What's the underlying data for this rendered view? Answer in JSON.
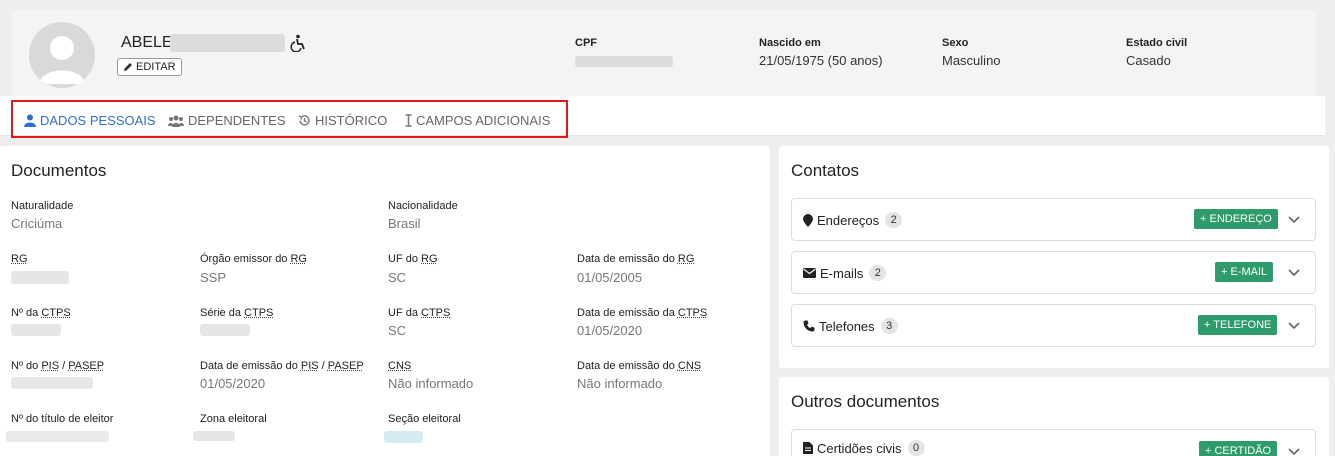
{
  "header": {
    "name": "ABELE",
    "edit_label": "EDITAR",
    "cpf_label": "CPF",
    "birth_label": "Nascido em",
    "birth_value": "21/05/1975 (50 anos)",
    "sex_label": "Sexo",
    "sex_value": "Masculino",
    "civil_label": "Estado civil",
    "civil_value": "Casado"
  },
  "tabs": [
    {
      "label": "DADOS PESSOAIS",
      "icon": "user-icon",
      "active": true
    },
    {
      "label": "DEPENDENTES",
      "icon": "users-icon",
      "active": false
    },
    {
      "label": "HISTÓRICO",
      "icon": "history-icon",
      "active": false
    },
    {
      "label": "CAMPOS ADICIONAIS",
      "icon": "text-cursor-icon",
      "active": false
    }
  ],
  "documentos": {
    "title": "Documentos",
    "naturalidade_label": "Naturalidade",
    "naturalidade_value": "Criciúma",
    "nacionalidade_label": "Nacionalidade",
    "nacionalidade_value": "Brasil",
    "rg_label": "RG",
    "orgao_rg_label_pre": "Órgão emissor do ",
    "orgao_rg_abbr": "RG",
    "orgao_rg_value": "SSP",
    "uf_rg_label_pre": "UF do ",
    "uf_rg_abbr": "RG",
    "uf_rg_value": "SC",
    "data_rg_label_pre": "Data de emissão do ",
    "data_rg_abbr": "RG",
    "data_rg_value": "01/05/2005",
    "ctps_label_pre": "Nº da ",
    "ctps_abbr": "CTPS",
    "serie_ctps_label_pre": "Série da ",
    "serie_ctps_abbr": "CTPS",
    "uf_ctps_label_pre": "UF da ",
    "uf_ctps_abbr": "CTPS",
    "uf_ctps_value": "SC",
    "data_ctps_label_pre": "Data de emissão da ",
    "data_ctps_abbr": "CTPS",
    "data_ctps_value": "01/05/2020",
    "pis_label_pre": "Nº do ",
    "pis_abbr": "PIS",
    "pis_sep": " / ",
    "pasep_abbr": "PASEP",
    "data_pis_label_pre": "Data de emissão do ",
    "data_pis_value": "01/05/2020",
    "cns_abbr": "CNS",
    "cns_value": "Não informado",
    "data_cns_label_pre": "Data de emissão do ",
    "data_cns_value": "Não informado",
    "titulo_label": "Nº do título de eleitor",
    "zona_label": "Zona eleitoral",
    "secao_label": "Seção eleitoral"
  },
  "contatos": {
    "title": "Contatos",
    "rows": [
      {
        "label": "Endereços",
        "count": "2",
        "button": "+ ENDEREÇO",
        "icon": "map-marker-icon"
      },
      {
        "label": "E-mails",
        "count": "2",
        "button": "+ E-MAIL",
        "icon": "envelope-icon"
      },
      {
        "label": "Telefones",
        "count": "3",
        "button": "+ TELEFONE",
        "icon": "phone-icon"
      }
    ]
  },
  "outros": {
    "title": "Outros documentos",
    "rows": [
      {
        "label": "Certidões civis",
        "count": "0",
        "button": "+ CERTIDÃO",
        "icon": "file-icon"
      }
    ]
  }
}
